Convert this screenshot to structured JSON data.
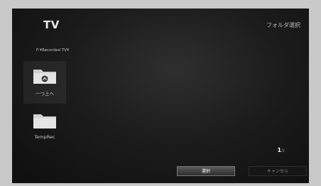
{
  "header": {
    "app_title": "TV",
    "dialog_title": "フォルダ選択"
  },
  "path": {
    "current": "F:¥Recorded TV¥"
  },
  "folders": [
    {
      "label": "一つ上へ",
      "icon": "folder-up-icon"
    },
    {
      "label": "TempRec",
      "icon": "folder-icon"
    }
  ],
  "pagination": {
    "current": "1",
    "total_text": "/2"
  },
  "buttons": {
    "select_label": "選択",
    "cancel_label": "キャンセル"
  },
  "colors": {
    "background": "#1c1c1c",
    "text": "#e8e8e8",
    "folder": "#d8d8d8"
  }
}
